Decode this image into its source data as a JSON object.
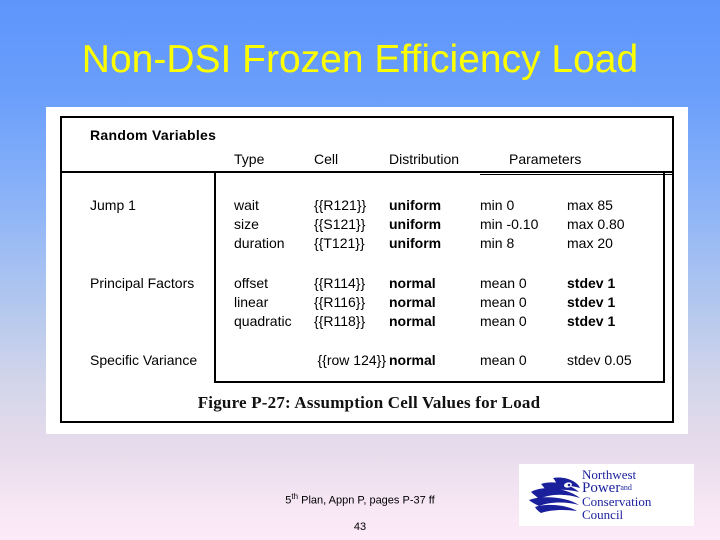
{
  "slide": {
    "title": "Non-DSI Frozen Efficiency Load",
    "title_color": "#ffff00",
    "background_top_color": "#5d95fb",
    "background_bottom_color": "#fdeaf8"
  },
  "figure": {
    "section_label": "Random Variables",
    "columns": [
      "Type",
      "Cell",
      "Distribution",
      "Parameters"
    ],
    "groups": [
      {
        "label": "Jump 1",
        "rows": [
          {
            "type": "wait",
            "cell": "{{R121}}",
            "distribution": "uniform",
            "param1": "min 0",
            "param2": "max 85"
          },
          {
            "type": "size",
            "cell": "{{S121}}",
            "distribution": "uniform",
            "param1": "min -0.10",
            "param2": "max 0.80"
          },
          {
            "type": "duration",
            "cell": "{{T121}}",
            "distribution": "uniform",
            "param1": "min 8",
            "param2": "max 20"
          }
        ]
      },
      {
        "label": "Principal Factors",
        "rows": [
          {
            "type": "offset",
            "cell": "{{R114}}",
            "distribution": "normal",
            "param1": "mean 0",
            "param2": "stdev 1"
          },
          {
            "type": "linear",
            "cell": "{{R116}}",
            "distribution": "normal",
            "param1": "mean 0",
            "param2": "stdev 1"
          },
          {
            "type": "quadratic",
            "cell": "{{R118}}",
            "distribution": "normal",
            "param1": "mean 0",
            "param2": "stdev 1"
          }
        ]
      },
      {
        "label": "Specific Variance",
        "rows": [
          {
            "type": "",
            "cell": "{{row 124}}",
            "distribution": "normal",
            "param1": "mean 0",
            "param2": "stdev 0.05"
          }
        ]
      }
    ],
    "caption": "Figure P-27:  Assumption Cell Values for Load"
  },
  "footer": {
    "source_prefix": "5",
    "source_superscript": "th",
    "source_rest": " Plan, Appn P, pages P-37 ff",
    "page_number": "43"
  },
  "logo": {
    "line1": "Northwest",
    "line2": "Power",
    "line2_small": "and",
    "line3": "Conservation",
    "line4": "Council",
    "color": "#1a1f9c",
    "mark": "fish-wave-emblem"
  }
}
